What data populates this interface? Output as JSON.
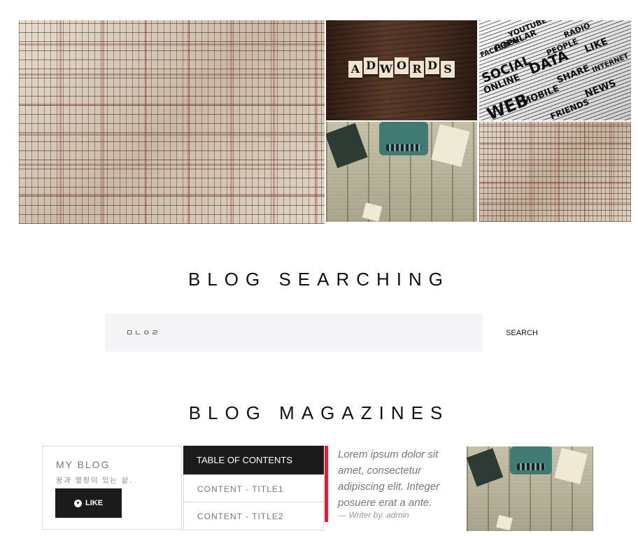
{
  "gallery": {
    "tiles": [
      "A",
      "D",
      "W",
      "O",
      "R",
      "D",
      "S"
    ],
    "words": [
      "YOUTUBE",
      "POPULAR",
      "SOCIAL",
      "DATA",
      "WEB",
      "LIKE",
      "SHARE",
      "ONLINE",
      "MOBILE",
      "FRIENDS",
      "NEWS",
      "FACEBOOK",
      "RADIO",
      "INTERNET",
      "PEOPLE"
    ]
  },
  "search": {
    "title": "BLOG SEARCHING",
    "value": "ㅁㄴㅇㄹ",
    "button_label": "SEARCH"
  },
  "magazines": {
    "title": "BLOG MAGAZINES",
    "blog_card": {
      "title": "MY BLOG",
      "subtitle": "꿈과 열정이 있는 삶.",
      "like_label": "LIKE",
      "like_icon": "heart-circle-icon"
    },
    "toc": {
      "header": "TABLE OF CONTENTS",
      "items": [
        "CONTENT - TITLE1",
        "CONTENT - TITLE2"
      ]
    },
    "quote": {
      "text": "Lorem ipsum dolor sit amet, consectetur adipiscing elit. Integer posuere erat a ante.",
      "author": "— Writer by. admin",
      "accent": "#d0253c"
    }
  }
}
